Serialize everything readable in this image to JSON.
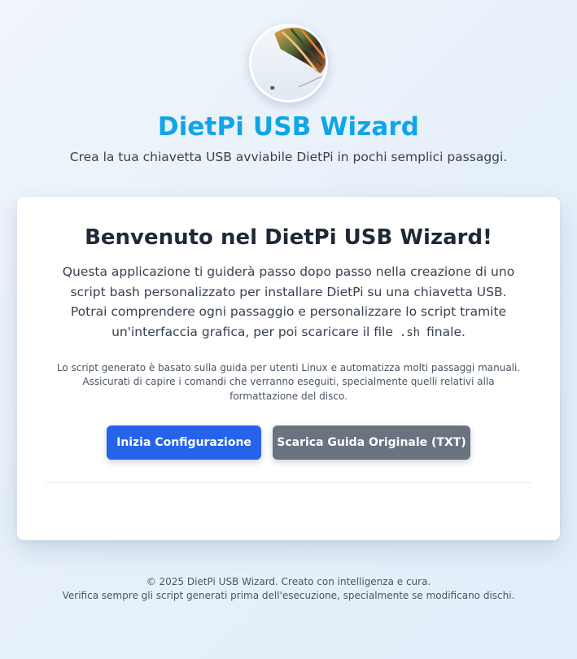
{
  "header": {
    "logo_icon": "hot-air-balloon-photo",
    "title": "DietPi USB Wizard",
    "subtitle": "Crea la tua chiavetta USB avviabile DietPi in pochi semplici passaggi."
  },
  "welcome": {
    "title": "Benvenuto nel DietPi USB Wizard!",
    "intro_before_code": "Questa applicazione ti guiderà passo dopo passo nella creazione di uno script bash personalizzato per installare DietPi su una chiavetta USB. Potrai comprendere ogni passaggio e personalizzare lo script tramite un'interfaccia grafica, per poi scaricare il file",
    "intro_code": ".sh",
    "intro_after_code": "finale.",
    "note": "Lo script generato è basato sulla guida per utenti Linux e automatizza molti passaggi manuali. Assicurati di capire i comandi che verranno eseguiti, specialmente quelli relativi alla formattazione del disco."
  },
  "actions": {
    "start_label": "Inizia Configurazione",
    "download_label": "Scarica Guida Originale (TXT)"
  },
  "footer": {
    "line1": "© 2025 DietPi USB Wizard. Creato con intelligenza e cura.",
    "line2": "Verifica sempre gli script generati prima dell'esecuzione, specialmente se modificano dischi."
  },
  "colors": {
    "title_accent": "#0ea5e9",
    "primary_button": "#2563eb",
    "secondary_button": "#6b7280"
  }
}
